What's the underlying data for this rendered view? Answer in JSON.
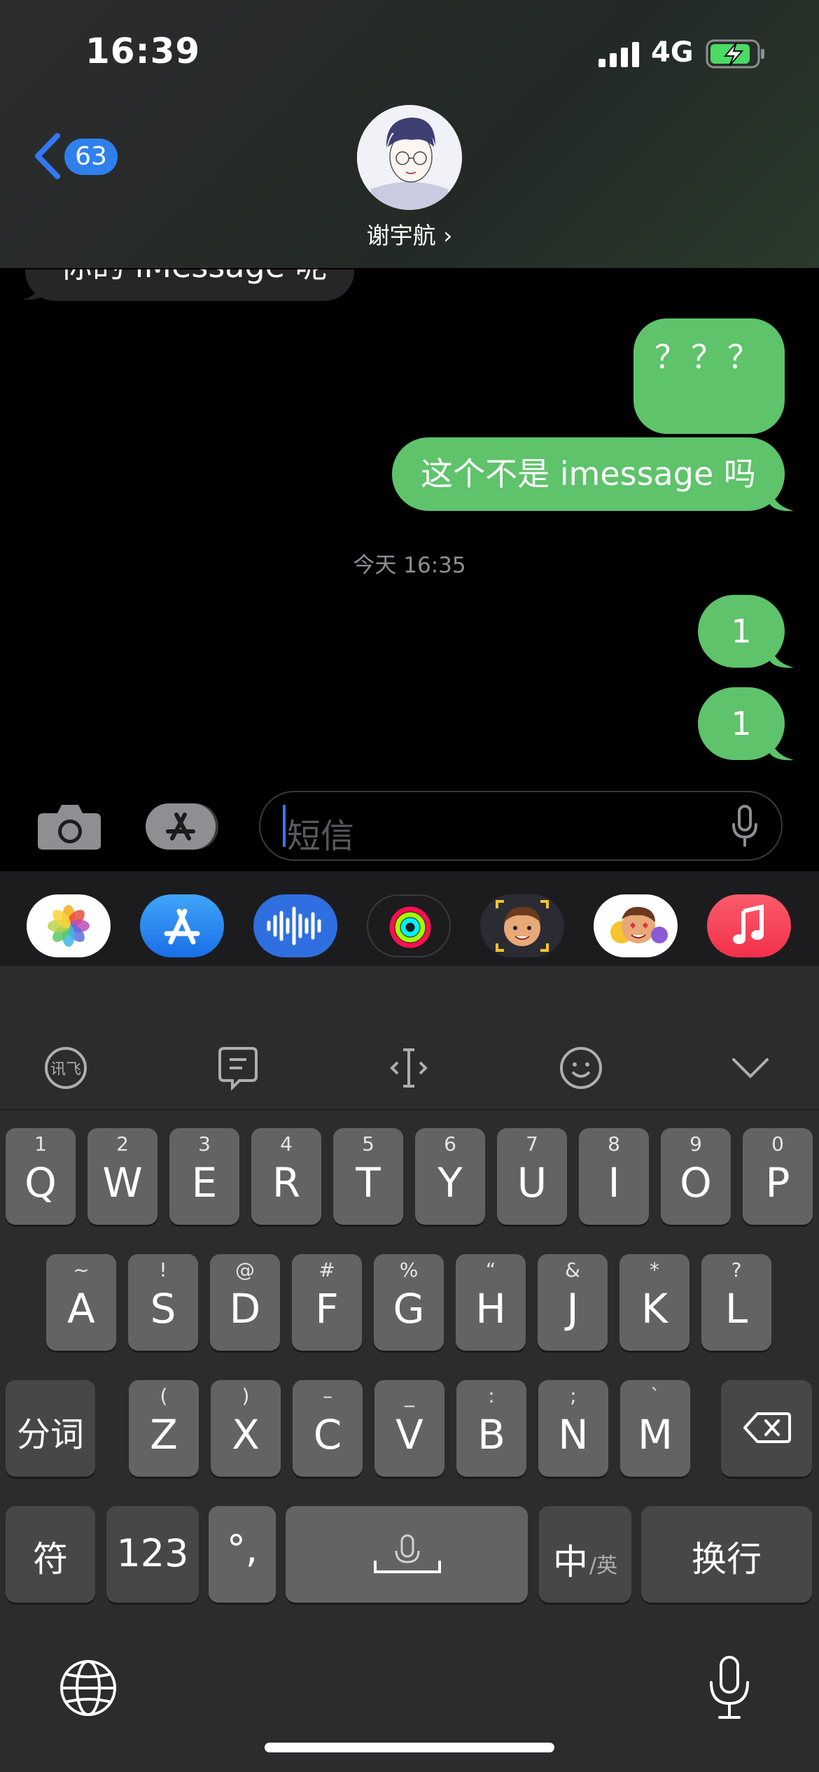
{
  "status_bar": {
    "time": "16:39",
    "network": "4G"
  },
  "header": {
    "back_count": "63",
    "contact_name": "谢宇航 ›"
  },
  "messages": {
    "partial_incoming": "你的 iMessage 呢",
    "out1": "？？？",
    "out2": "这个不是 imessage 吗",
    "timestamp": "今天 16:35",
    "out3": "1",
    "out4": "1"
  },
  "input": {
    "placeholder": "短信"
  },
  "apps": [
    "photos-icon",
    "app-store-icon",
    "audio-message-icon",
    "activity-icon",
    "memoji-icon",
    "animoji-stickers-icon",
    "music-icon"
  ],
  "keyboard": {
    "row1": [
      [
        "1",
        "Q"
      ],
      [
        "2",
        "W"
      ],
      [
        "3",
        "E"
      ],
      [
        "4",
        "R"
      ],
      [
        "5",
        "T"
      ],
      [
        "6",
        "Y"
      ],
      [
        "7",
        "U"
      ],
      [
        "8",
        "I"
      ],
      [
        "9",
        "O"
      ],
      [
        "0",
        "P"
      ]
    ],
    "row2": [
      [
        "~",
        "A"
      ],
      [
        "!",
        "S"
      ],
      [
        "@",
        "D"
      ],
      [
        "#",
        "F"
      ],
      [
        "%",
        "G"
      ],
      [
        "“",
        "H"
      ],
      [
        "&",
        "J"
      ],
      [
        "*",
        "K"
      ],
      [
        "?",
        "L"
      ]
    ],
    "row3": [
      [
        "(",
        "Z"
      ],
      [
        ")",
        "X"
      ],
      [
        "–",
        "C"
      ],
      [
        "_",
        "V"
      ],
      [
        ":",
        "B"
      ],
      [
        ";",
        "N"
      ],
      [
        "`",
        "M"
      ]
    ],
    "fenci": "分词",
    "fu": "符",
    "num": "123",
    "punct": "°,",
    "zh": "中",
    "en": "/英",
    "enter": "换行"
  }
}
